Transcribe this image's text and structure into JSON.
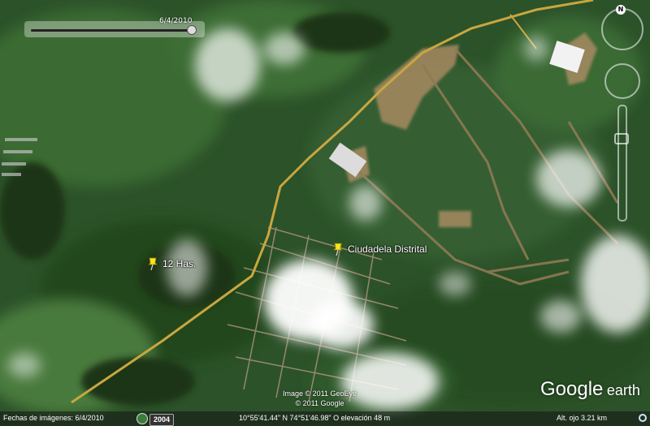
{
  "time_slider": {
    "date": "6/4/2010"
  },
  "placemarks": [
    {
      "label": "12 Has."
    },
    {
      "label": "Ciudadela Distrital"
    }
  ],
  "navigation": {
    "compass_letter": "N"
  },
  "credits": {
    "line1": "Image © 2011 GeoEye",
    "line2": "© 2011 Google"
  },
  "logo": {
    "word1": "Google",
    "word2": "earth"
  },
  "status_bar": {
    "imagery_date": "Fechas de imágenes: 6/4/2010",
    "year": "2004",
    "coordinates": "10°55'41.44\" N  74°51'46.98\" O elevación   48 m",
    "eye_alt": "Alt. ojo    3.21 km"
  },
  "colors": {
    "pin": "#f5e51c",
    "road": "#c9a640",
    "vegetation": "#2f5a2c"
  }
}
